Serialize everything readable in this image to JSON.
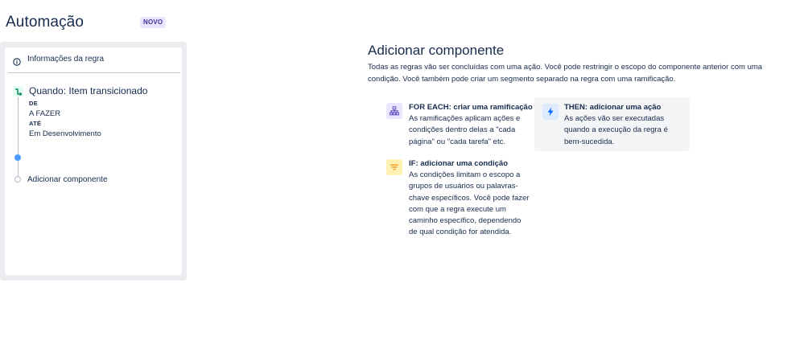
{
  "header": {
    "title": "Automação",
    "badge": "NOVO"
  },
  "rule": {
    "info_label": "Informações da regra",
    "trigger": {
      "title": "Quando: Item transicionado",
      "from_label": "DE",
      "from_value": "A FAZER",
      "to_label": "ATÉ",
      "to_value": "Em Desenvolvimento"
    },
    "add_component_label": "Adicionar componente"
  },
  "main": {
    "title": "Adicionar componente",
    "description": "Todas as regras vão ser concluídas com uma ação. Você pode restringir o escopo do componente anterior com uma condição. Você também pode criar um segmento separado na regra com uma ramificação.",
    "options": {
      "branch": {
        "title": "FOR EACH: criar uma ramificação",
        "description": "As ramificações aplicam ações e condições dentro delas a \"cada página\" ou \"cada tarefa\" etc.",
        "icon": "branch-icon"
      },
      "action": {
        "title": "THEN: adicionar uma ação",
        "description": "As ações vão ser executadas quando a execução da regra é bem-sucedida.",
        "icon": "lightning-icon"
      },
      "condition": {
        "title": "IF: adicionar uma condição",
        "description": "As condições limitam o escopo a grupos de usuários ou palavras-chave específicos. Você pode fazer com que a regra execute um caminho específico, dependendo de qual condição for atendida.",
        "icon": "filter-icon"
      }
    }
  },
  "colors": {
    "text": "#172b4d",
    "branch_bg": "#eae6ff",
    "branch_fg": "#6554c0",
    "action_bg": "#deebff",
    "action_fg": "#0065ff",
    "condition_bg": "#fff0b3",
    "condition_fg": "#ff991f",
    "trigger_bg": "#e3fcef",
    "trigger_fg": "#00875a",
    "active_dot": "#4c9aff"
  }
}
